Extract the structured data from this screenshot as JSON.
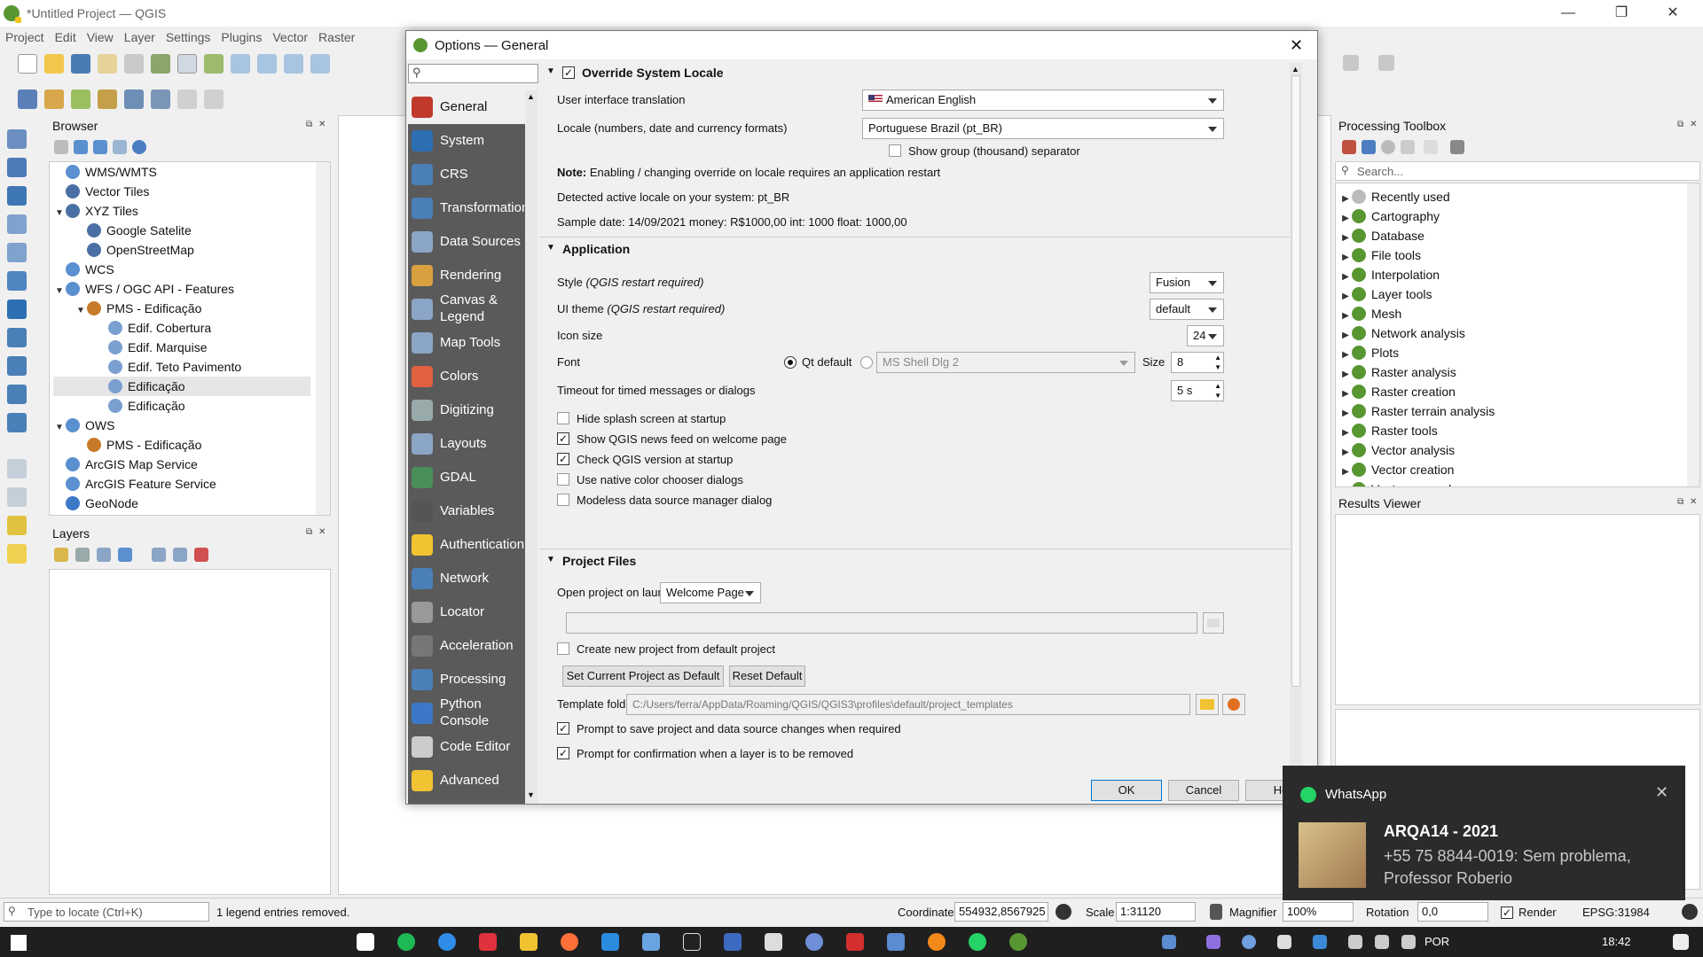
{
  "window": {
    "title": "*Untitled Project — QGIS"
  },
  "menu": [
    "Project",
    "Edit",
    "View",
    "Layer",
    "Settings",
    "Plugins",
    "Vector",
    "Raster"
  ],
  "browser": {
    "title": "Browser",
    "items": [
      {
        "label": "WMS/WMTS",
        "indent": 0
      },
      {
        "label": "Vector Tiles",
        "indent": 0
      },
      {
        "label": "XYZ Tiles",
        "indent": 0,
        "expanded": true
      },
      {
        "label": "Google Satelite",
        "indent": 1
      },
      {
        "label": "OpenStreetMap",
        "indent": 1
      },
      {
        "label": "WCS",
        "indent": 0
      },
      {
        "label": "WFS / OGC API - Features",
        "indent": 0,
        "expanded": true
      },
      {
        "label": "PMS - Edificação",
        "indent": 1,
        "expanded": true
      },
      {
        "label": "Edif. Cobertura",
        "indent": 2
      },
      {
        "label": "Edif. Marquise",
        "indent": 2
      },
      {
        "label": "Edif. Teto Pavimento",
        "indent": 2
      },
      {
        "label": "Edificação",
        "indent": 2,
        "selected": true
      },
      {
        "label": "Edificação",
        "indent": 2
      },
      {
        "label": "OWS",
        "indent": 0,
        "expanded": true
      },
      {
        "label": "PMS - Edificação",
        "indent": 1
      },
      {
        "label": "ArcGIS Map Service",
        "indent": 0
      },
      {
        "label": "ArcGIS Feature Service",
        "indent": 0
      },
      {
        "label": "GeoNode",
        "indent": 0
      }
    ]
  },
  "layers": {
    "title": "Layers"
  },
  "dialog": {
    "title": "Options — General",
    "search_placeholder": "",
    "nav": [
      "General",
      "System",
      "CRS",
      "Transformations",
      "Data Sources",
      "Rendering",
      "Canvas & Legend",
      "Map Tools",
      "Colors",
      "Digitizing",
      "Layouts",
      "GDAL",
      "Variables",
      "Authentication",
      "Network",
      "Locator",
      "Acceleration",
      "Processing",
      "Python Console",
      "Code Editor",
      "Advanced"
    ],
    "override": {
      "title": "Override System Locale",
      "ui_translation_label": "User interface translation",
      "ui_translation_value": "American English",
      "locale_label": "Locale (numbers, date and currency formats)",
      "locale_value": "Portuguese Brazil (pt_BR)",
      "group_sep_label": "Show group (thousand) separator",
      "note_bold": "Note:",
      "note_text": " Enabling / changing override on locale requires an application restart",
      "detected": "Detected active locale on your system: pt_BR",
      "sample": "Sample date: 14/09/2021 money: R$1000,00 int: 1000 float: 1000,00"
    },
    "application": {
      "title": "Application",
      "style_label": "Style",
      "style_note": "(QGIS restart required)",
      "style_value": "Fusion",
      "theme_label": "UI theme",
      "theme_note": "(QGIS restart required)",
      "theme_value": "default",
      "iconsize_label": "Icon size",
      "iconsize_value": "24",
      "font_label": "Font",
      "font_qt_default": "Qt default",
      "font_family": "MS Shell Dlg 2",
      "font_size_label": "Size",
      "font_size_value": "8",
      "timeout_label": "Timeout for timed messages or dialogs",
      "timeout_value": "5 s",
      "checks": [
        {
          "label": "Hide splash screen at startup",
          "checked": false
        },
        {
          "label": "Show QGIS news feed on welcome page",
          "checked": true
        },
        {
          "label": "Check QGIS version at startup",
          "checked": true
        },
        {
          "label": "Use native color chooser dialogs",
          "checked": false
        },
        {
          "label": "Modeless data source manager dialog",
          "checked": false
        }
      ]
    },
    "project_files": {
      "title": "Project Files",
      "open_label": "Open project on launch",
      "open_value": "Welcome Page",
      "path_value": "",
      "create_default_label": "Create new project from default project",
      "set_current_btn": "Set Current Project as Default",
      "reset_default_btn": "Reset Default",
      "template_label": "Template folder",
      "template_value": "C:/Users/ferra/AppData/Roaming/QGIS/QGIS3\\profiles\\default/project_templates",
      "prompt_save": "Prompt to save project and data source changes when required",
      "prompt_remove": "Prompt for confirmation when a layer is to be removed"
    },
    "buttons": {
      "ok": "OK",
      "cancel": "Cancel",
      "help": "He"
    }
  },
  "processing": {
    "title": "Processing Toolbox",
    "search_placeholder": "Search...",
    "items": [
      "Recently used",
      "Cartography",
      "Database",
      "File tools",
      "Interpolation",
      "Layer tools",
      "Mesh",
      "Network analysis",
      "Plots",
      "Raster analysis",
      "Raster creation",
      "Raster terrain analysis",
      "Raster tools",
      "Vector analysis",
      "Vector creation",
      "Vector general"
    ]
  },
  "results": {
    "title": "Results Viewer"
  },
  "statusbar": {
    "locate_placeholder": "Type to locate (Ctrl+K)",
    "message": "1 legend entries removed.",
    "coord_label": "Coordinate",
    "coord_value": "554932,8567925",
    "scale_label": "Scale",
    "scale_value": "1:31120",
    "magnifier_label": "Magnifier",
    "magnifier_value": "100%",
    "rotation_label": "Rotation",
    "rotation_value": "0,0",
    "render_label": "Render",
    "crs": "EPSG:31984"
  },
  "toast": {
    "app": "WhatsApp",
    "title": "ARQA14 - 2021",
    "message": "+55 75 8844-0019: Sem problema, Professor Roberio"
  },
  "taskbar": {
    "lang": "POR",
    "time": "18:42"
  }
}
